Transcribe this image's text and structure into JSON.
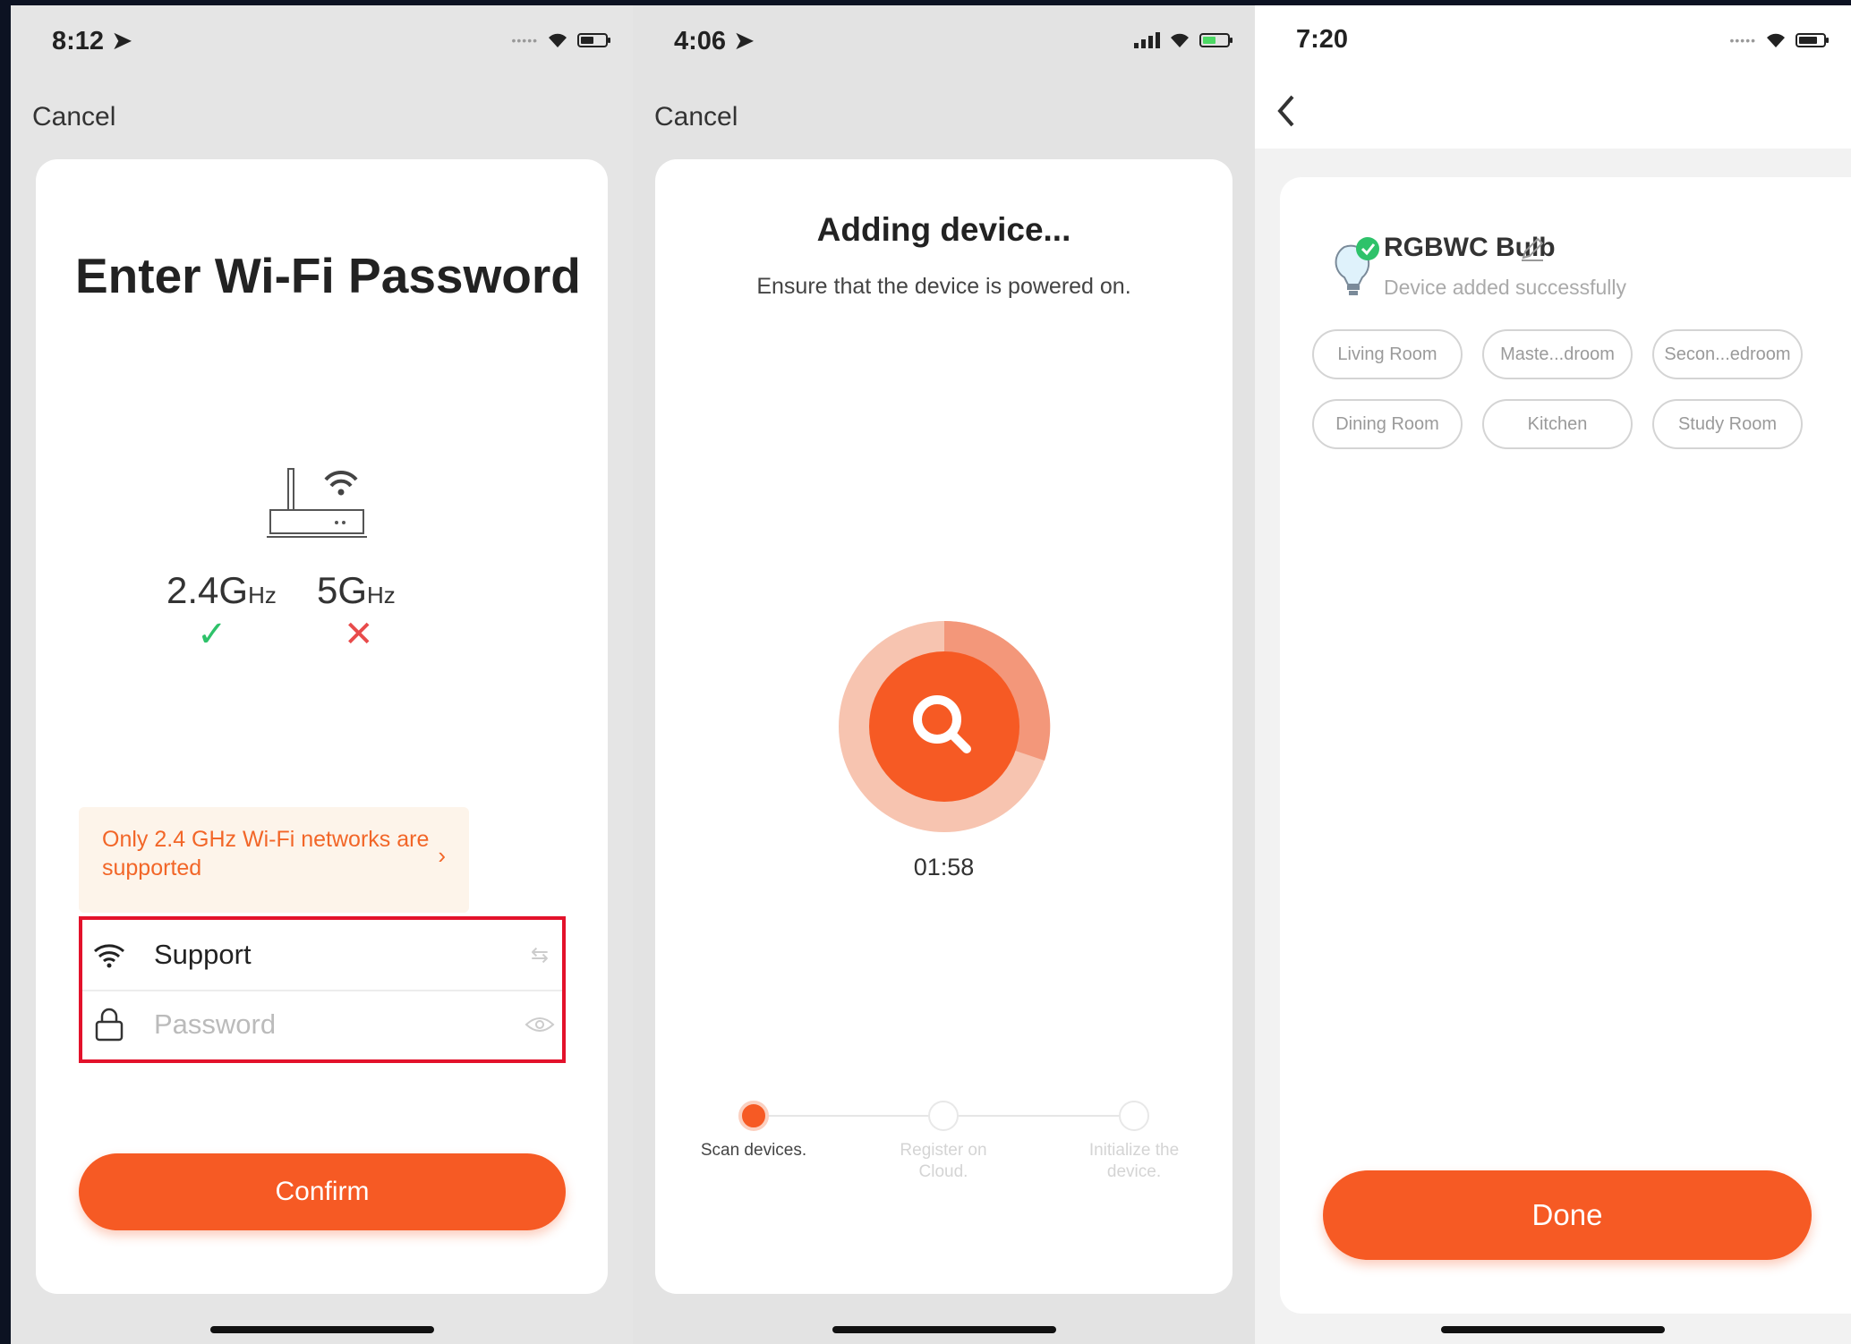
{
  "panel1": {
    "status": {
      "time": "8:12 ➤"
    },
    "cancel": "Cancel",
    "title": "Enter Wi-Fi Password",
    "band_24": {
      "main": "2.4G",
      "unit": "Hz",
      "mark": "✓"
    },
    "band_5": {
      "main": "5G",
      "unit": "Hz",
      "mark": "✕"
    },
    "notice": "Only 2.4 GHz Wi-Fi networks are supported",
    "notice_arrow": "›",
    "ssid": "Support",
    "password_placeholder": "Password",
    "confirm": "Confirm",
    "colors": {
      "accent": "#f65a24",
      "ok": "#2ec26a",
      "bad": "#e84b4b",
      "highlight": "#e3122b"
    }
  },
  "panel2": {
    "status": {
      "time": "4:06 ➤"
    },
    "cancel": "Cancel",
    "title": "Adding device...",
    "subtitle": "Ensure that the device is powered on.",
    "timer": "01:58",
    "steps": [
      {
        "label": "Scan devices.",
        "active": true
      },
      {
        "label": "Register on Cloud.",
        "active": false
      },
      {
        "label": "Initialize the device.",
        "active": false
      }
    ]
  },
  "panel3": {
    "status": {
      "time": "7:20"
    },
    "device_name": "RGBWC Bulb",
    "device_status": "Device added successfully",
    "rooms": [
      "Living Room",
      "Maste...droom",
      "Secon...edroom",
      "Dining Room",
      "Kitchen",
      "Study Room"
    ],
    "done": "Done"
  }
}
